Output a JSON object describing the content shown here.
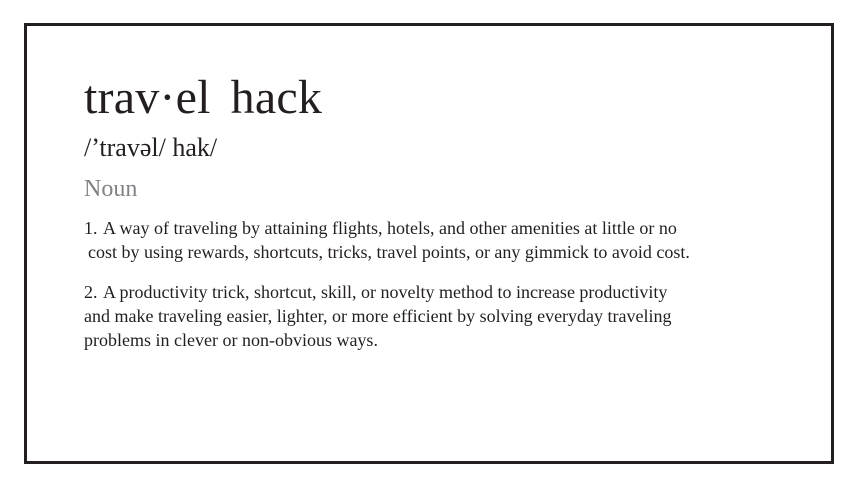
{
  "entry": {
    "headword_part1": "trav·el",
    "headword_part2": "hack",
    "pronunciation": "/’travəl/ hak/",
    "part_of_speech": "Noun",
    "definitions": [
      {
        "number": "1.",
        "lines": [
          "A way of traveling by attaining flights, hotels, and other amenities at little or no",
          "cost by using rewards, shortcuts, tricks, travel points, or any gimmick to avoid cost."
        ]
      },
      {
        "number": "2.",
        "lines": [
          "A productivity trick, shortcut, skill, or novelty method to increase productivity",
          "and make traveling easier, lighter, or more efficient by solving everyday traveling",
          "problems in clever or non-obvious ways."
        ]
      }
    ]
  },
  "colors": {
    "text": "#231f20",
    "muted": "#808285",
    "border": "#231f20",
    "background": "#ffffff"
  }
}
